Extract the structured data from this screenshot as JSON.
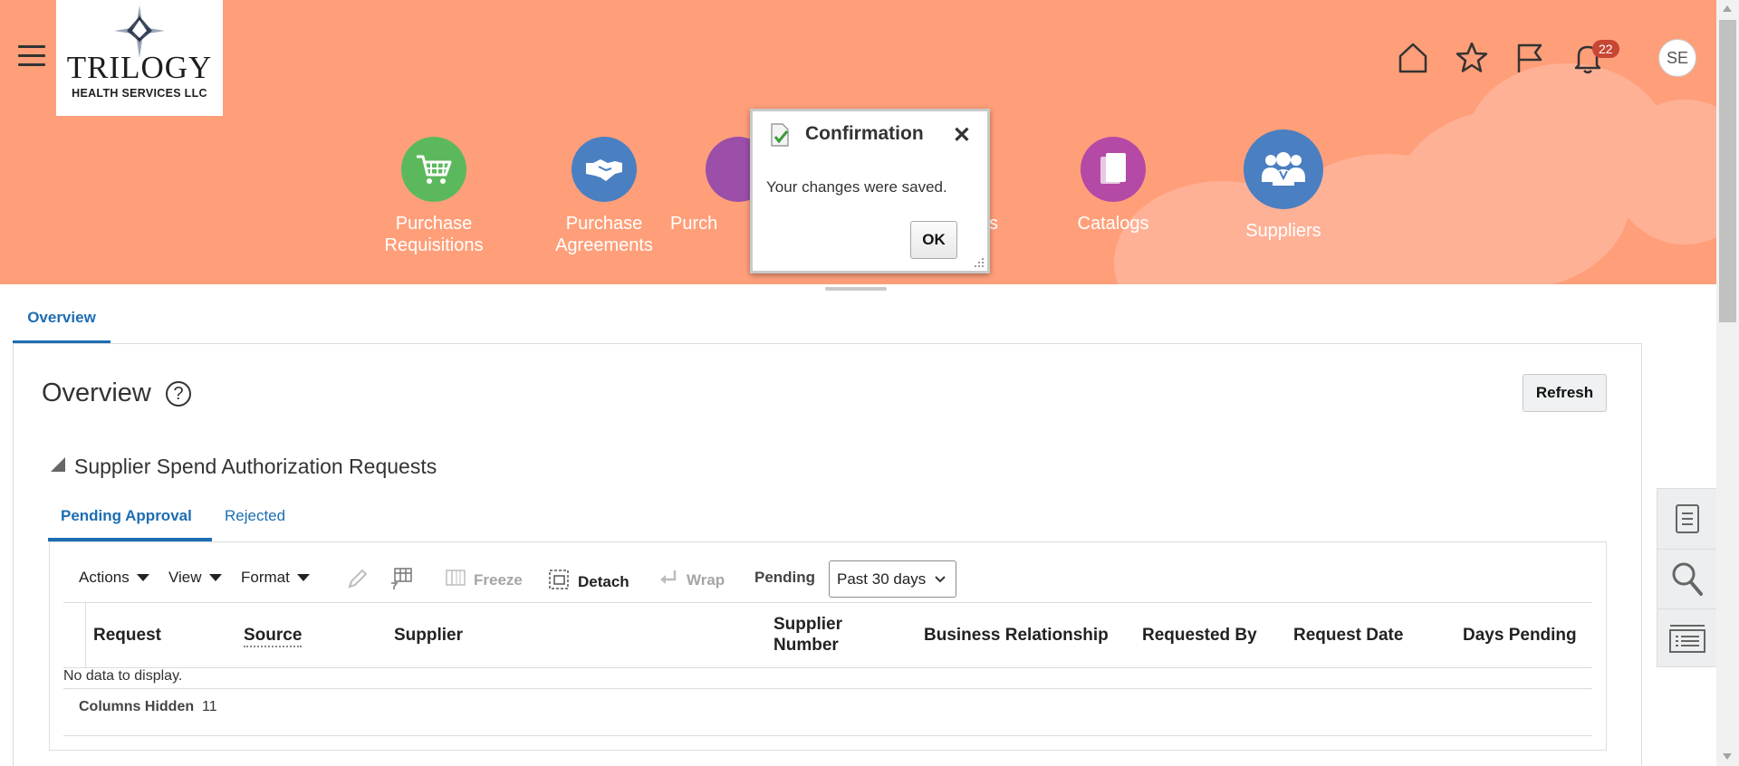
{
  "header": {
    "logo": {
      "line1": "TRILOGY",
      "line2": "HEALTH SERVICES LLC"
    },
    "notification_count": "22",
    "avatar_initials": "SE",
    "background_color": "#ff9f7a"
  },
  "nav_tiles": [
    {
      "label": "Purchase Requisitions",
      "color": "#5cb85c",
      "icon": "shopping-cart-icon"
    },
    {
      "label": "Purchase Agreements",
      "color": "#4a7fc1",
      "icon": "handshake-icon"
    },
    {
      "label": "Purch",
      "color": "#9b4fa8",
      "icon": "purchase-orders-icon"
    },
    {
      "label": "s",
      "color": "#9b4fa8",
      "icon": "unknown-icon"
    },
    {
      "label": "Catalogs",
      "color": "#b449a6",
      "icon": "catalog-icon"
    },
    {
      "label": "Suppliers",
      "color": "#4a7fc1",
      "icon": "suppliers-icon"
    }
  ],
  "dialog": {
    "title": "Confirmation",
    "close": "✕",
    "message": "Your changes were saved.",
    "ok_label": "OK"
  },
  "tabs": {
    "overview": "Overview"
  },
  "page": {
    "title": "Overview",
    "help": "?",
    "refresh_label": "Refresh"
  },
  "section": {
    "title": "Supplier Spend Authorization Requests",
    "subtabs": {
      "pending": "Pending Approval",
      "rejected": "Rejected"
    }
  },
  "toolbar": {
    "actions": "Actions",
    "view": "View",
    "format": "Format",
    "freeze": "Freeze",
    "detach": "Detach",
    "wrap": "Wrap",
    "pending_label": "Pending",
    "pending_value": "Past 30 days"
  },
  "table": {
    "columns": [
      "Request",
      "Source",
      "Supplier",
      "Supplier Number",
      "Business Relationship",
      "Requested By",
      "Request Date",
      "Days Pending"
    ],
    "no_data": "No data to display.",
    "columns_hidden_label": "Columns Hidden",
    "columns_hidden_count": "11"
  }
}
